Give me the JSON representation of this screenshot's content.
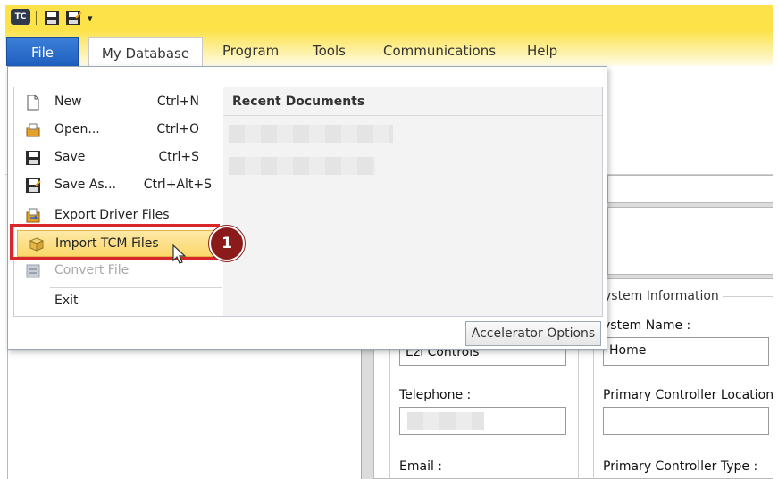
{
  "quick_access": {
    "logo_text": "TC"
  },
  "tabs": {
    "file": "File",
    "my_database": "My Database",
    "program": "Program",
    "tools": "Tools",
    "communications": "Communications",
    "help": "Help"
  },
  "file_menu": {
    "items": [
      {
        "label": "New",
        "shortcut": "Ctrl+N"
      },
      {
        "label": "Open...",
        "shortcut": "Ctrl+O"
      },
      {
        "label": "Save",
        "shortcut": "Ctrl+S"
      },
      {
        "label": "Save As...",
        "shortcut": "Ctrl+Alt+S"
      },
      {
        "label": "Export Driver Files",
        "shortcut": ""
      },
      {
        "label": "Import TCM Files",
        "shortcut": ""
      },
      {
        "label": "Convert File",
        "shortcut": ""
      },
      {
        "label": "Exit",
        "shortcut": ""
      }
    ],
    "recent_title": "Recent Documents",
    "accelerator_button": "Accelerator Options"
  },
  "callout": {
    "number": "1"
  },
  "form": {
    "system_info_title": "ystem Information",
    "system_name_label": "ystem Name :",
    "system_name_value": "Home",
    "company_value": "Ezi Controls",
    "telephone_label": "Telephone :",
    "primary_location_label": "Primary Controller Location",
    "email_label": "Email :",
    "primary_type_label": "Primary Controller Type :"
  },
  "colors": {
    "ribbon_yellow": "#fde24a",
    "file_blue": "#1f5fbf",
    "highlight": "#fbd86a",
    "callout_red": "#d9262b",
    "badge": "#8b1a1a"
  }
}
